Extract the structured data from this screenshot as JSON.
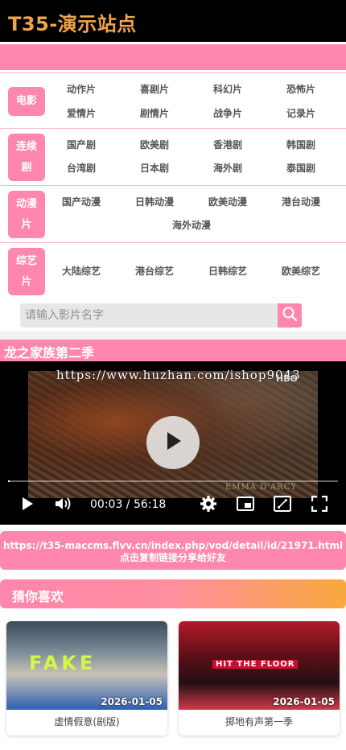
{
  "site": {
    "title": "T35-演示站点"
  },
  "categories": [
    {
      "label": "电影",
      "items": [
        "动作片",
        "喜剧片",
        "科幻片",
        "恐怖片",
        "爱情片",
        "剧情片",
        "战争片",
        "记录片"
      ]
    },
    {
      "label": "连续剧",
      "items": [
        "国产剧",
        "欧美剧",
        "香港剧",
        "韩国剧",
        "台湾剧",
        "日本剧",
        "海外剧",
        "泰国剧"
      ]
    },
    {
      "label": "动漫片",
      "items": [
        "国产动漫",
        "日韩动漫",
        "欧美动漫",
        "港台动漫",
        "海外动漫"
      ]
    },
    {
      "label": "综艺片",
      "items": [
        "大陆综艺",
        "港台综艺",
        "日韩综艺",
        "欧美综艺"
      ]
    }
  ],
  "search": {
    "placeholder": "请输入影片名字",
    "icon": "search-icon"
  },
  "video": {
    "title": "龙之家族第二季",
    "watermark": "https://www.huzhan.com/ishop9043",
    "channel_badge": "HBO",
    "credit": "EMMA D'ARCY",
    "current_time": "00:03",
    "duration": "56:18",
    "time_display": "00:03 / 56:18",
    "progress_fraction": 0.001
  },
  "share": {
    "url": "https://t35-maccms.flvv.cn/index.php/vod/detail/id/21971.html",
    "tip": "点击复制链接分享给好友"
  },
  "recommend": {
    "title": "猜你喜欢",
    "items": [
      {
        "title": "虚情假意(剧版)",
        "date": "2026-01-05",
        "poster_text": "FAKE"
      },
      {
        "title": "掷地有声第一季",
        "date": "2026-01-05",
        "poster_text": "HIT THE FLOOR"
      }
    ]
  },
  "colors": {
    "accent": "#ff86ad",
    "header_bg": "#000000",
    "title": "#f0a34a",
    "gradient_end": "#f7a93c"
  }
}
